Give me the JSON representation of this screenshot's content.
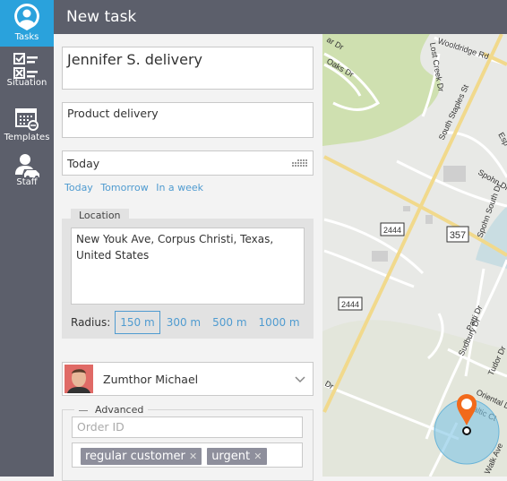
{
  "sidebar": {
    "items": [
      {
        "label": "Tasks",
        "icon": "user-pin-icon",
        "active": true
      },
      {
        "label": "Situation",
        "icon": "checklist-icon"
      },
      {
        "label": "Templates",
        "icon": "calendar-icon"
      },
      {
        "label": "Staff",
        "icon": "driver-icon"
      }
    ]
  },
  "header": {
    "title": "New task"
  },
  "form": {
    "title_value": "Jennifer S. delivery",
    "description_value": "Product delivery",
    "date_value": "Today",
    "date_shortcuts": [
      "Today",
      "Tomorrow",
      "In a week"
    ],
    "location": {
      "tab_label": "Location",
      "address": "New Youk Ave, Corpus Christi, Texas, United States",
      "radius_label": "Radius:",
      "radius_options": [
        "150 m",
        "300 m",
        "500 m",
        "1000 m"
      ],
      "selected_radius": "150 m"
    },
    "staff": {
      "name": "Zumthor Michael"
    },
    "advanced": {
      "label": "Advanced",
      "order_id_placeholder": "Order ID",
      "tags": [
        "regular customer",
        "urgent"
      ]
    }
  },
  "map": {
    "labels": {
      "wooldridge": "Wooldridge Rd",
      "lostcreek": "Lost Creek Dr",
      "staples": "South Staples St",
      "oaks": "Oaks Dr",
      "ar": "ar Dr",
      "spohn": "Spohn Dr",
      "spohnsouth": "Spohn South Dr",
      "esp": "Esp",
      "patti": "Patti Dr",
      "sudbury": "Sudbury Dr",
      "tudor": "Tudor Dr",
      "oriental": "Oriental Dr",
      "baltic": "Baltic Ct",
      "walk": "Walk Ave",
      "dr": "Dr"
    },
    "shields": [
      "2444",
      "357",
      "2444"
    ],
    "accent": "#f26a1b",
    "radius_fill": "#7fc4e4"
  }
}
